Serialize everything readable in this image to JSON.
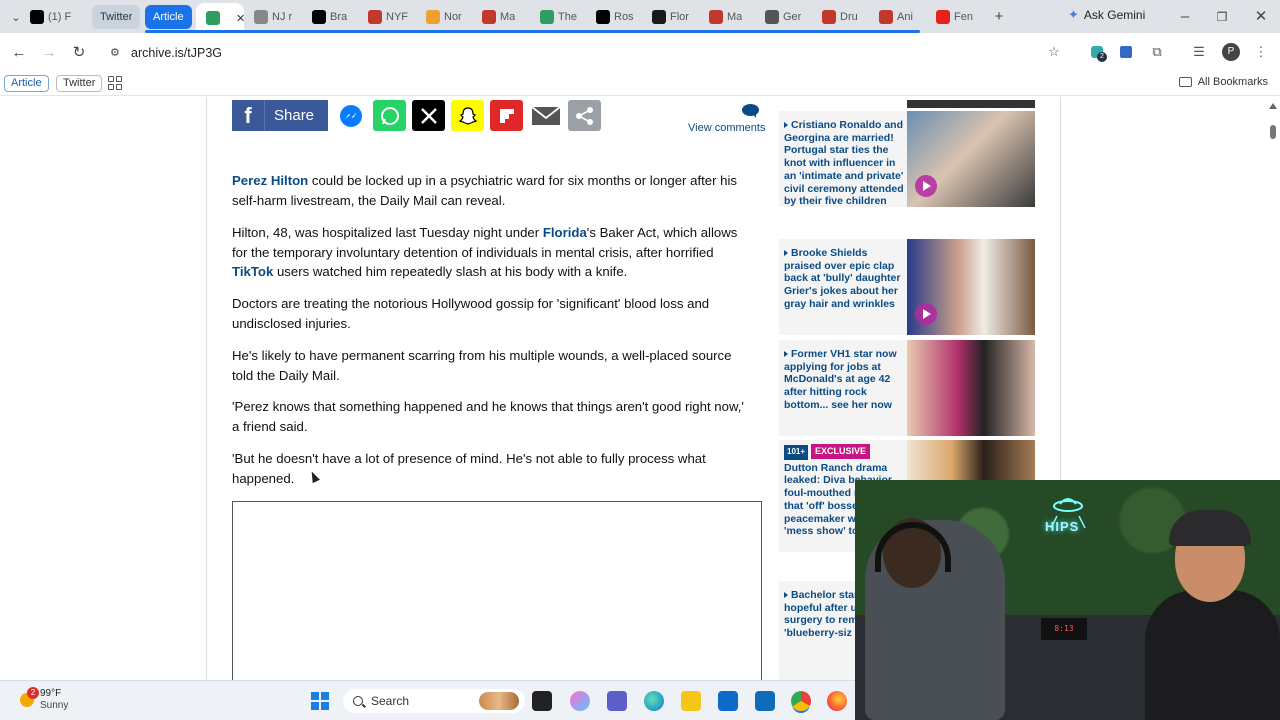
{
  "browser": {
    "tabs": [
      {
        "label": "(1) F",
        "fav": "x-logo",
        "color": "#000000"
      },
      {
        "label": "Twitter",
        "grouped": true
      },
      {
        "label": "Article",
        "grouped": true,
        "blue": true
      },
      {
        "label": "",
        "active": true,
        "fav": "archive-icon",
        "color": "#2e9c63"
      },
      {
        "label": "NJ r",
        "fav": "email-icon",
        "color": "#888888"
      },
      {
        "label": "Bra",
        "fav": "threads-icon",
        "color": "#000000"
      },
      {
        "label": "NYF",
        "fav": "archive-red-icon",
        "color": "#c0392b"
      },
      {
        "label": "Nor",
        "fav": "circle-icon",
        "color": "#f0a030"
      },
      {
        "label": "Ma",
        "fav": "archive-red-icon",
        "color": "#c0392b"
      },
      {
        "label": "The",
        "fav": "archive-icon",
        "color": "#2e9c63"
      },
      {
        "label": "Ros",
        "fav": "threads-icon",
        "color": "#000000"
      },
      {
        "label": "Flor",
        "fav": "square-icon",
        "color": "#1a1a1a"
      },
      {
        "label": "Ma",
        "fav": "archive-red-icon",
        "color": "#c0392b"
      },
      {
        "label": "Ger",
        "fav": "dots-icon",
        "color": "#555555"
      },
      {
        "label": "Dru",
        "fav": "archive-red-icon",
        "color": "#c0392b"
      },
      {
        "label": "Ani",
        "fav": "archive-red-icon",
        "color": "#c0392b"
      },
      {
        "label": "Fen",
        "fav": "youtube-icon",
        "color": "#e62117"
      }
    ],
    "new_tab": "+",
    "ask_gemini": "Ask Gemini",
    "url": "archive.is/tJP3G",
    "profile_initial": "P",
    "extension_badge": "2"
  },
  "bookmarks": {
    "chips": [
      "Article",
      "Twitter"
    ],
    "all_bookmarks": "All Bookmarks"
  },
  "share": {
    "facebook_letter": "f",
    "facebook_label": "Share",
    "view_comments": "View comments"
  },
  "article": {
    "paragraphs": [
      {
        "parts": [
          {
            "t": "Perez Hilton",
            "link": true
          },
          {
            "t": " could be locked up in a psychiatric ward for six months or longer after his self-harm livestream, the Daily Mail can reveal."
          }
        ]
      },
      {
        "parts": [
          {
            "t": "Hilton, 48, was hospitalized last Tuesday night under "
          },
          {
            "t": "Florida",
            "link": true
          },
          {
            "t": "'s Baker Act, which allows for the temporary involuntary detention of individuals in mental crisis, after horrified "
          },
          {
            "t": "TikTok",
            "link": true
          },
          {
            "t": " users watched him repeatedly slash at his body with a knife."
          }
        ]
      },
      {
        "parts": [
          {
            "t": "Doctors are treating the notorious Hollywood gossip for 'significant' blood loss and undisclosed injuries."
          }
        ]
      },
      {
        "parts": [
          {
            "t": "He's likely to have permanent scarring from his multiple wounds, a well-placed source told the Daily Mail."
          }
        ]
      },
      {
        "parts": [
          {
            "t": "'Perez knows that something happened and he knows that things aren't good right now,' a friend said."
          }
        ]
      },
      {
        "parts": [
          {
            "t": "'But he doesn't have a lot of presence of mind. He's not able to fully process what happened."
          }
        ]
      }
    ]
  },
  "sidebar": {
    "items": [
      {
        "title": "Cristiano Ronaldo and Georgina are married! Portugal star ties the knot with influencer in an 'intimate and private' civil ceremony attended by their five children",
        "has_play": true
      },
      {
        "title": "Brooke Shields praised over epic clap back at 'bully' daughter Grier's jokes about her gray hair and wrinkles",
        "has_play": true
      },
      {
        "title": "Former VH1 star now applying for jobs at McDonald's at age 42 after hitting rock bottom... see her now",
        "has_play": false
      },
      {
        "plus": "101+",
        "badge": "EXCLUSIVE",
        "title": "Dutton Ranch drama leaked: Diva behavior, foul-mouthed meltdown that 'off' bosses and peacemaker w holding 'mess show' togethe",
        "has_play": false
      },
      {
        "title": "Bachelor star shares hopeful after undergoi surgery to rem 'blueberry-siz",
        "has_play": false
      }
    ]
  },
  "webcam": {
    "sign": "HIPS",
    "clock": "8:13"
  },
  "taskbar": {
    "temp": "99°F",
    "condition": "Sunny",
    "weather_badge": "2",
    "search": "Search"
  }
}
